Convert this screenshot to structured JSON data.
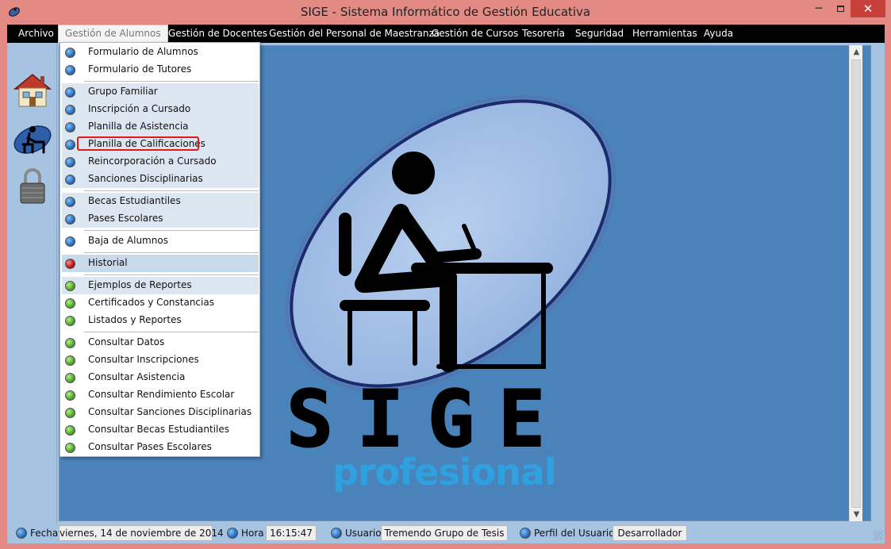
{
  "window": {
    "title": "SIGE - Sistema Informático de Gestión Educativa",
    "minimize_glyph": "─",
    "close_glyph": "✕"
  },
  "menubar": {
    "items": [
      "Archivo",
      "Gestión de Alumnos",
      "Gestión de Docentes",
      "Gestión del Personal de Maestranza",
      "Gestión de Cursos",
      "Tesorería",
      "Seguridad",
      "Herramientas",
      "Ayuda"
    ],
    "active_index": 1
  },
  "sidebar": {
    "buttons": [
      "house-icon",
      "student-desk-icon",
      "padlock-icon"
    ]
  },
  "logo": {
    "title": "SIGE",
    "subtitle": "profesional"
  },
  "dropdown": {
    "items": [
      {
        "label": "Formulario de Alumnos",
        "bullet": "blue"
      },
      {
        "label": "Formulario de Tutores",
        "bullet": "blue"
      },
      {
        "label": "Grupo Familiar",
        "bullet": "blue"
      },
      {
        "label": "Inscripción a Cursado",
        "bullet": "blue"
      },
      {
        "label": "Planilla de Asistencia",
        "bullet": "blue"
      },
      {
        "label": "Planilla de Calificaciones",
        "bullet": "blue",
        "highlighted": true
      },
      {
        "label": "Reincorporación a Cursado",
        "bullet": "blue"
      },
      {
        "label": "Sanciones Disciplinarias",
        "bullet": "blue"
      },
      {
        "label": "Becas Estudiantiles",
        "bullet": "blue"
      },
      {
        "label": "Pases Escolares",
        "bullet": "blue"
      },
      {
        "label": "Baja de Alumnos",
        "bullet": "blue"
      },
      {
        "label": "Historial",
        "bullet": "red"
      },
      {
        "label": "Ejemplos de Reportes",
        "bullet": "green"
      },
      {
        "label": "Certificados y Constancias",
        "bullet": "green"
      },
      {
        "label": "Listados y Reportes",
        "bullet": "green"
      },
      {
        "label": "Consultar Datos",
        "bullet": "green"
      },
      {
        "label": "Consultar Inscripciones",
        "bullet": "green"
      },
      {
        "label": "Consultar Asistencia",
        "bullet": "green"
      },
      {
        "label": "Consultar Rendimiento Escolar",
        "bullet": "green"
      },
      {
        "label": "Consultar Sanciones Disciplinarias",
        "bullet": "green"
      },
      {
        "label": "Consultar Becas Estudiantiles",
        "bullet": "green"
      },
      {
        "label": "Consultar Pases Escolares",
        "bullet": "green"
      }
    ]
  },
  "statusbar": {
    "fecha_label": "Fecha",
    "fecha_value": "viernes, 14 de noviembre de 2014",
    "hora_label": "Hora",
    "hora_value": "16:15:47",
    "usuario_label": "Usuario",
    "usuario_value": "Tremendo Grupo de Tesis",
    "perfil_label": "Perfil del Usuario",
    "perfil_value": "Desarrollador"
  },
  "colors": {
    "titlebar": "#e38a84",
    "menubar": "#000000",
    "workspace": "#4a82ba",
    "sidebar": "#a7c3e2",
    "focus_outline": "#e01818"
  }
}
